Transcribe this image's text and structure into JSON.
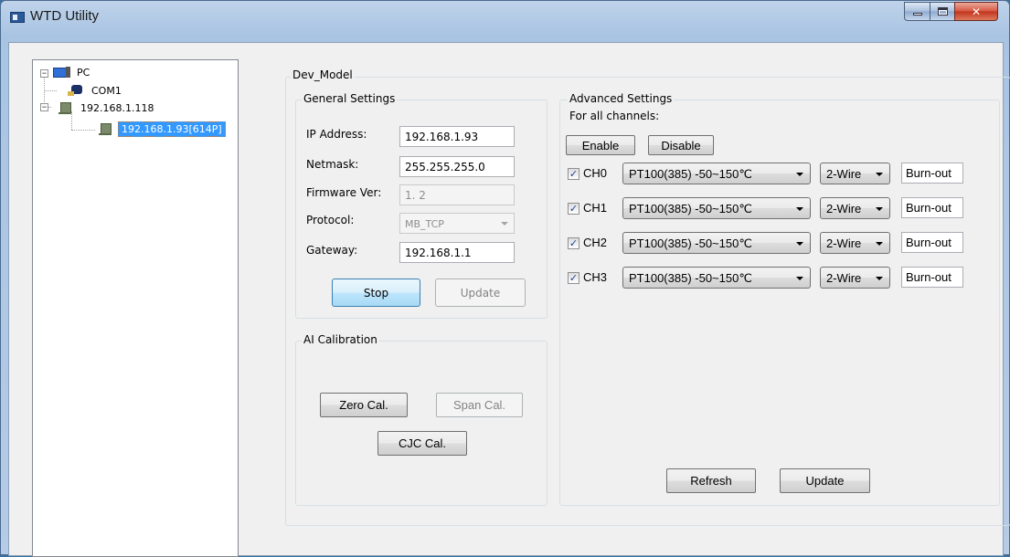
{
  "window": {
    "title": "WTD Utility",
    "controls": {
      "minimize": "minimize",
      "maximize": "maximize",
      "close": "close"
    }
  },
  "tree": {
    "root": "PC",
    "com": "COM1",
    "ip_node": "192.168.1.118",
    "device": "192.168.1.93[614P]"
  },
  "dev_model": {
    "title": "Dev_Model",
    "general": {
      "title": "General Settings",
      "ip_label": "IP Address:",
      "ip_value": "192.168.1.93",
      "netmask_label": "Netmask:",
      "netmask_value": "255.255.255.0",
      "firmware_label": "Firmware Ver:",
      "firmware_value": "1. 2",
      "protocol_label": "Protocol:",
      "protocol_value": "MB_TCP",
      "gateway_label": "Gateway:",
      "gateway_value": "192.168.1.1",
      "stop_button": "Stop",
      "update_button": "Update"
    },
    "calibration": {
      "title": "AI Calibration",
      "zero_button": "Zero Cal.",
      "span_button": "Span Cal.",
      "cjc_button": "CJC Cal."
    },
    "advanced": {
      "title": "Advanced Settings",
      "all_channels_label": "For all channels:",
      "enable_button": "Enable",
      "disable_button": "Disable",
      "channels": [
        {
          "name": "CH0",
          "checked": "✓",
          "sensor": "PT100(385) -50~150℃",
          "wire": "2-Wire",
          "burnout": "Burn-out"
        },
        {
          "name": "CH1",
          "checked": "✓",
          "sensor": "PT100(385) -50~150℃",
          "wire": "2-Wire",
          "burnout": "Burn-out"
        },
        {
          "name": "CH2",
          "checked": "✓",
          "sensor": "PT100(385) -50~150℃",
          "wire": "2-Wire",
          "burnout": "Burn-out"
        },
        {
          "name": "CH3",
          "checked": "✓",
          "sensor": "PT100(385) -50~150℃",
          "wire": "2-Wire",
          "burnout": "Burn-out"
        }
      ],
      "refresh_button": "Refresh",
      "update_button": "Update"
    }
  }
}
